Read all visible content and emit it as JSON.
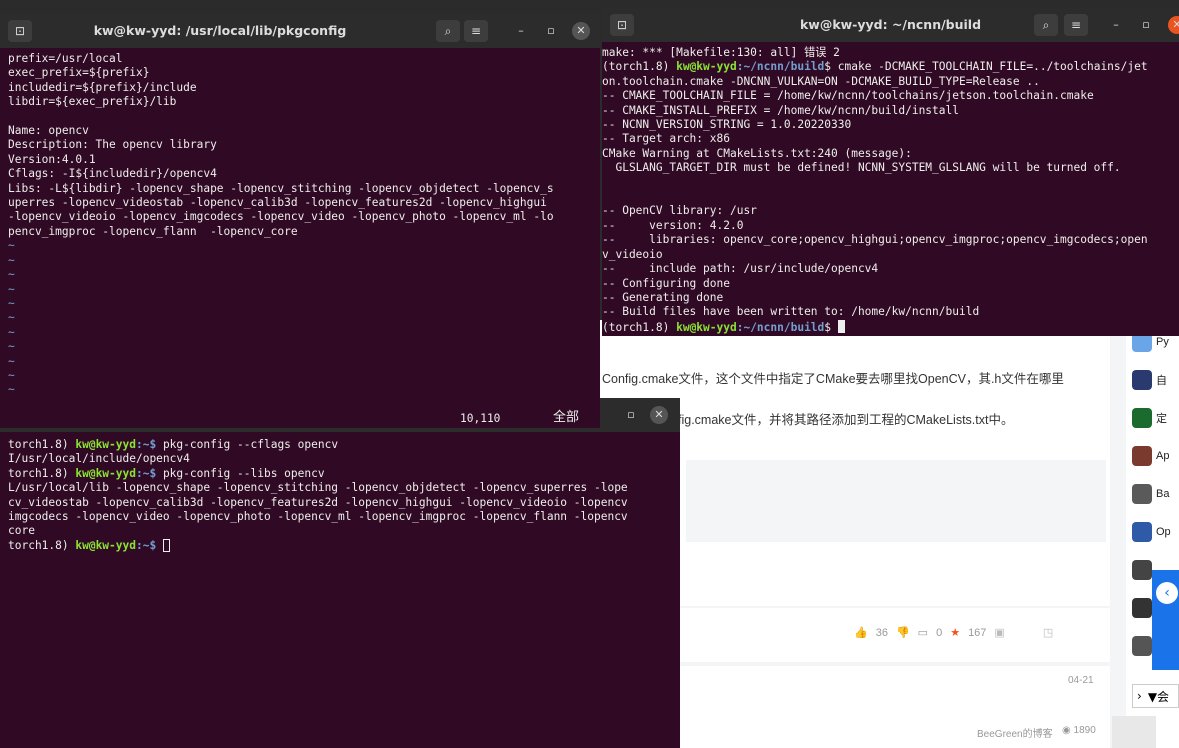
{
  "desktop": {
    "bg": "#2b2b2b"
  },
  "terminal_left": {
    "title": "kw@kw-yyd: /usr/local/lib/pkgconfig",
    "lines": [
      "prefix=/usr/local",
      "exec_prefix=${prefix}",
      "includedir=${prefix}/include",
      "libdir=${exec_prefix}/lib",
      "",
      "Name: opencv",
      "Description: The opencv library",
      "Version:4.0.1",
      "Cflags: -I${includedir}/opencv4",
      "Libs: -L${libdir} -lopencv_shape -lopencv_stitching -lopencv_objdetect -lopencv_s",
      "uperres -lopencv_videostab -lopencv_calib3d -lopencv_features2d -lopencv_highgui",
      "-lopencv_videoio -lopencv_imgcodecs -lopencv_video -lopencv_photo -lopencv_ml -lo",
      "pencv_imgproc -lopencv_flann  -lopencv_core"
    ],
    "tildes": [
      "~",
      "~",
      "~",
      "~",
      "~",
      "~",
      "~",
      "~",
      "~",
      "~",
      "~",
      "~"
    ],
    "status_pos": "10,110",
    "status_all": "全部"
  },
  "terminal_bottom": {
    "lines_before_user": "torch1.8) ",
    "user": "kw@kw-yyd",
    "path": ":~$",
    "cmd1": " pkg-config --cflags opencv",
    "out1": "I/usr/local/include/opencv4",
    "cmd2": " pkg-config --libs opencv",
    "out2": [
      "L/usr/local/lib -lopencv_shape -lopencv_stitching -lopencv_objdetect -lopencv_superres -lope",
      "cv_videostab -lopencv_calib3d -lopencv_features2d -lopencv_highgui -lopencv_videoio -lopencv",
      "imgcodecs -lopencv_video -lopencv_photo -lopencv_ml -lopencv_imgproc -lopencv_flann -lopencv",
      "core"
    ]
  },
  "terminal_right": {
    "title": "kw@kw-yyd: ~/ncnn/build",
    "line_error": "make: *** [Makefile:130: all] 错误 2",
    "env": "(torch1.8) ",
    "user": "kw@kw-yyd",
    "path": ":~/ncnn/build",
    "prompt_symbol": "$",
    "cmd": " cmake -DCMAKE_TOOLCHAIN_FILE=../toolchains/jet",
    "lines": [
      "on.toolchain.cmake -DNCNN_VULKAN=ON -DCMAKE_BUILD_TYPE=Release ..",
      "-- CMAKE_TOOLCHAIN_FILE = /home/kw/ncnn/toolchains/jetson.toolchain.cmake",
      "-- CMAKE_INSTALL_PREFIX = /home/kw/ncnn/build/install",
      "-- NCNN_VERSION_STRING = 1.0.20220330",
      "-- Target arch: x86",
      "CMake Warning at CMakeLists.txt:240 (message):",
      "  GLSLANG_TARGET_DIR must be defined! NCNN_SYSTEM_GLSLANG will be turned off.",
      "",
      "",
      "-- OpenCV library: /usr",
      "--     version: 4.2.0",
      "--     libraries: opencv_core;opencv_highgui;opencv_imgproc;opencv_imgcodecs;open",
      "v_videoio",
      "--     include path: /usr/include/opencv4",
      "-- Configuring done",
      "-- Generating done",
      "-- Build files have been written to: /home/kw/ncnn/build"
    ]
  },
  "webpage": {
    "text1": "Config.cmake文件，这个文件中指定了CMake要去哪里找OpenCV，其.h文件在哪里",
    "text2": "fig.cmake文件，并将其路径添加到工程的CMakeLists.txt中。",
    "like_count": "36",
    "comment_count": "0",
    "fav_count": "167",
    "date": "04-21",
    "author": "BeeGreen的博客",
    "views": "1890",
    "side_items": [
      "Py",
      "自",
      "定",
      "Ap",
      "Ba",
      "Op",
      "",
      ""
    ],
    "bottom_right": "▼会"
  }
}
